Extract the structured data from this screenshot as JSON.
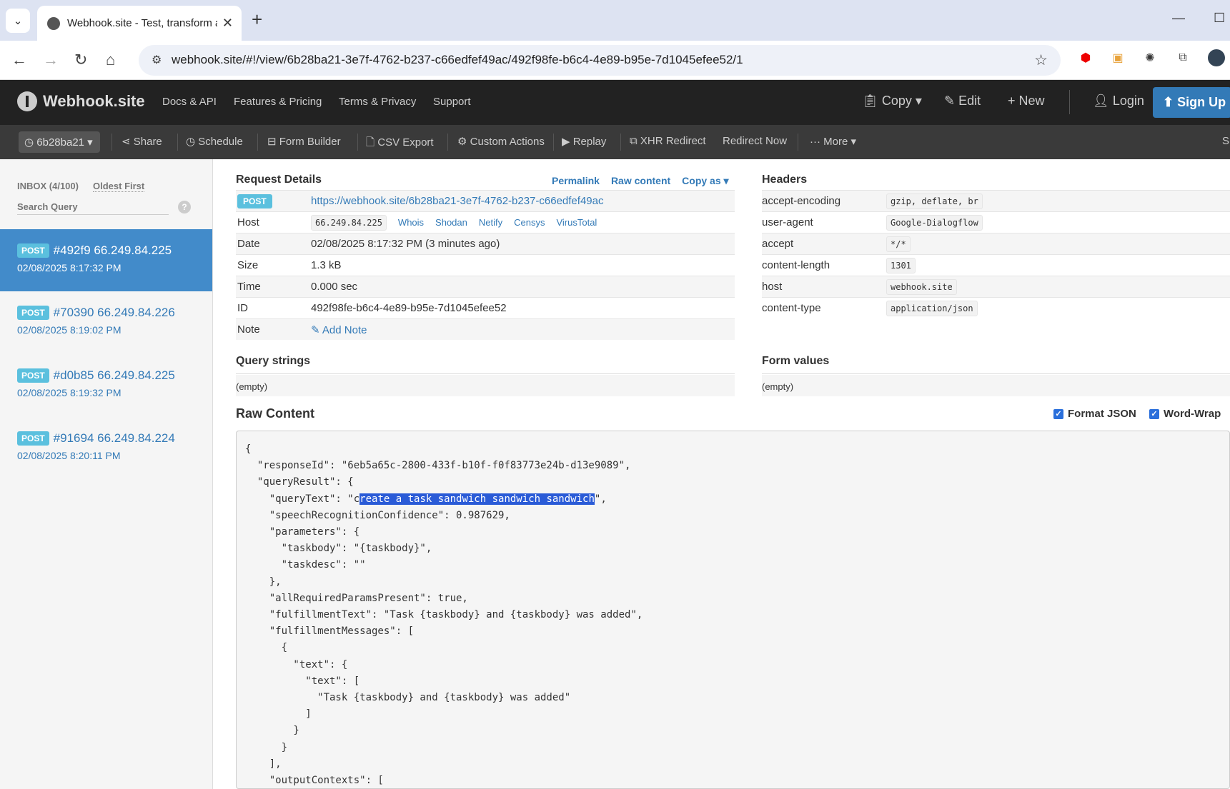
{
  "browser": {
    "tab_title": "Webhook.site - Test, transform a",
    "url": "webhook.site/#!/view/6b28ba21-3e7f-4762-b237-c66edfef49ac/492f98fe-b6c4-4e89-b95e-7d1045efee52/1"
  },
  "header": {
    "logo": "Webhook.site",
    "nav": [
      "Docs & API",
      "Features & Pricing",
      "Terms & Privacy",
      "Support"
    ],
    "copy": "Copy",
    "edit": "Edit",
    "new": "New",
    "login": "Login",
    "signup": "Sign Up"
  },
  "toolbar": {
    "token": "6b28ba21",
    "share": "Share",
    "schedule": "Schedule",
    "form_builder": "Form Builder",
    "csv_export": "CSV Export",
    "custom_actions": "Custom Actions",
    "replay": "Replay",
    "xhr_redirect": "XHR Redirect",
    "redirect_now": "Redirect Now",
    "more": "More",
    "edge": "S"
  },
  "sidebar": {
    "inbox": "INBOX (4/100)",
    "oldest": "Oldest First",
    "search_placeholder": "Search Query",
    "help": "?",
    "requests": [
      {
        "method": "POST",
        "title": "#492f9 66.249.84.225",
        "time": "02/08/2025 8:17:32 PM"
      },
      {
        "method": "POST",
        "title": "#70390 66.249.84.226",
        "time": "02/08/2025 8:19:02 PM"
      },
      {
        "method": "POST",
        "title": "#d0b85 66.249.84.225",
        "time": "02/08/2025 8:19:32 PM"
      },
      {
        "method": "POST",
        "title": "#91694 66.249.84.224",
        "time": "02/08/2025 8:20:11 PM"
      }
    ]
  },
  "request_details": {
    "heading": "Request Details",
    "permalink": "Permalink",
    "raw_content": "Raw content",
    "copy_as": "Copy as",
    "method": "POST",
    "url": "https://webhook.site/6b28ba21-3e7f-4762-b237-c66edfef49ac",
    "host_label": "Host",
    "host": "66.249.84.225",
    "host_links": [
      "Whois",
      "Shodan",
      "Netify",
      "Censys",
      "VirusTotal"
    ],
    "date_label": "Date",
    "date": "02/08/2025 8:17:32 PM (3 minutes ago)",
    "size_label": "Size",
    "size": "1.3 kB",
    "time_label": "Time",
    "time": "0.000 sec",
    "id_label": "ID",
    "id": "492f98fe-b6c4-4e89-b95e-7d1045efee52",
    "note_label": "Note",
    "add_note": "Add Note"
  },
  "headers": {
    "heading": "Headers",
    "rows": [
      {
        "key": "accept-encoding",
        "value": "gzip, deflate, br"
      },
      {
        "key": "user-agent",
        "value": "Google-Dialogflow"
      },
      {
        "key": "accept",
        "value": "*/*"
      },
      {
        "key": "content-length",
        "value": "1301"
      },
      {
        "key": "host",
        "value": "webhook.site"
      },
      {
        "key": "content-type",
        "value": "application/json"
      }
    ]
  },
  "query_strings": {
    "heading": "Query strings",
    "value": "(empty)"
  },
  "form_values": {
    "heading": "Form values",
    "value": "(empty)"
  },
  "raw": {
    "heading": "Raw Content",
    "format_json": "Format JSON",
    "word_wrap": "Word-Wrap",
    "before_sel": "{\n  \"responseId\": \"6eb5a65c-2800-433f-b10f-f0f83773e24b-d13e9089\",\n  \"queryResult\": {\n    \"queryText\": \"c",
    "selected": "reate a task sandwich sandwich sandwich",
    "after_sel": "\",\n    \"speechRecognitionConfidence\": 0.987629,\n    \"parameters\": {\n      \"taskbody\": \"{taskbody}\",\n      \"taskdesc\": \"\"\n    },\n    \"allRequiredParamsPresent\": true,\n    \"fulfillmentText\": \"Task {taskbody} and {taskbody} was added\",\n    \"fulfillmentMessages\": [\n      {\n        \"text\": {\n          \"text\": [\n            \"Task {taskbody} and {taskbody} was added\"\n          ]\n        }\n      }\n    ],\n    \"outputContexts\": ["
  }
}
